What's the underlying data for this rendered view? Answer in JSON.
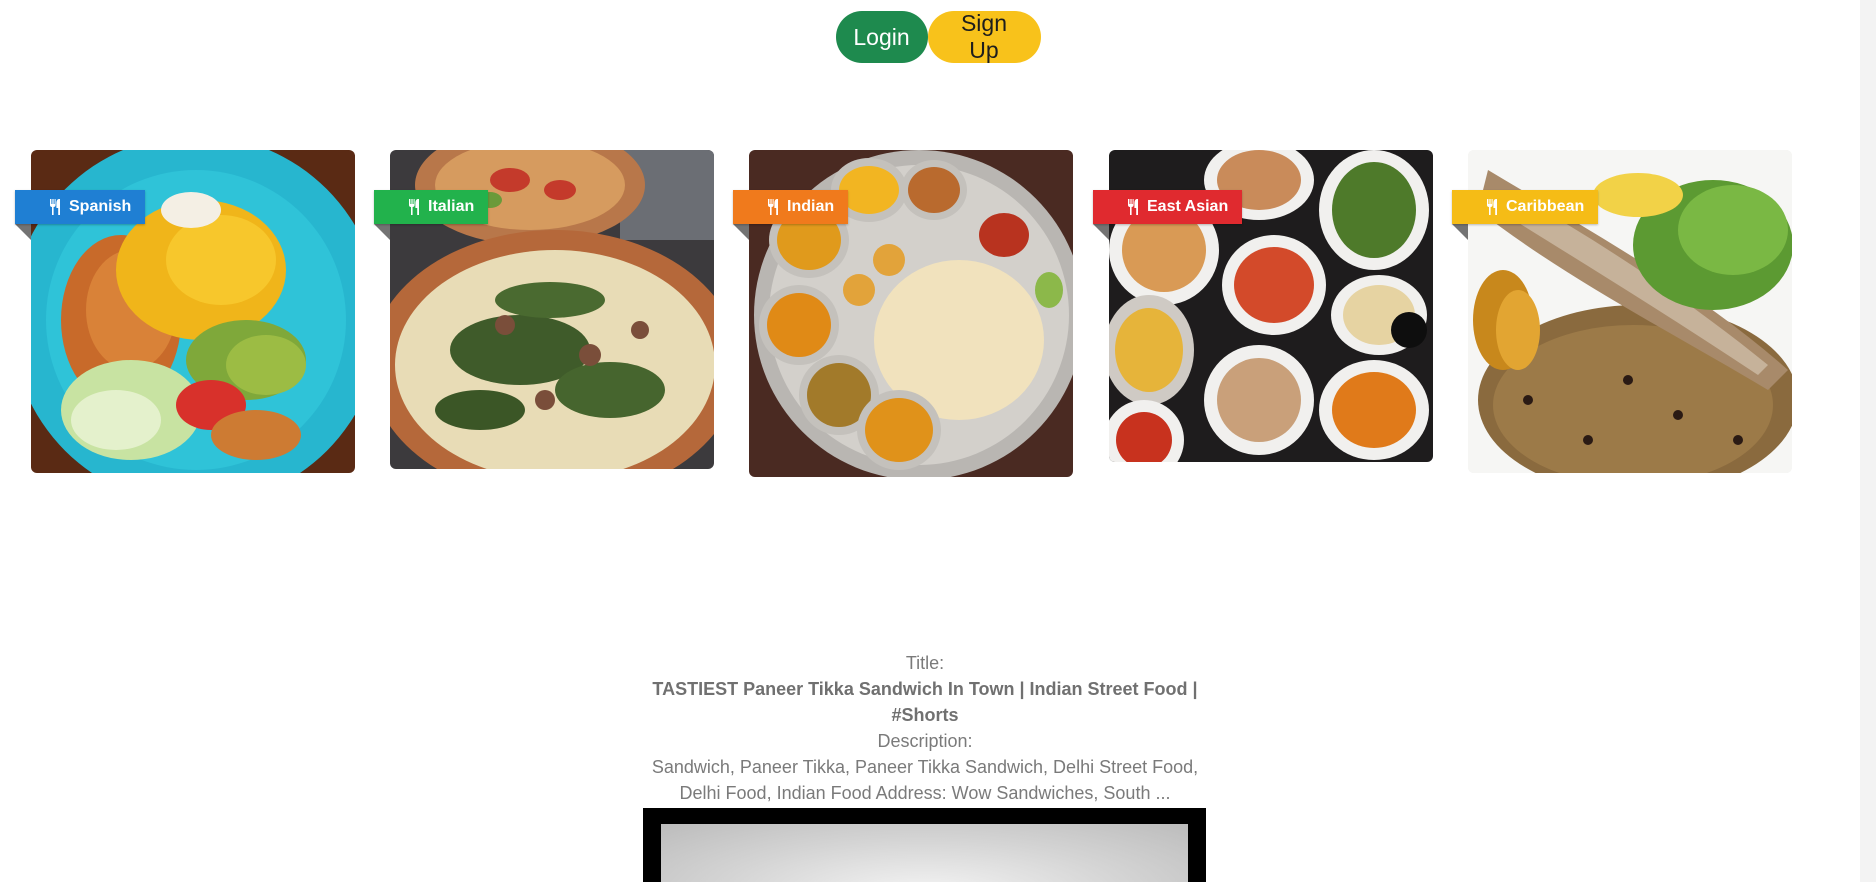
{
  "auth": {
    "login_label": "Login",
    "signup_label": "Sign Up"
  },
  "categories": [
    {
      "label": "Spanish",
      "color": "#1f7fd3"
    },
    {
      "label": "Italian",
      "color": "#22b24c"
    },
    {
      "label": "Indian",
      "color": "#f07a1c"
    },
    {
      "label": "East Asian",
      "color": "#e02a2f"
    },
    {
      "label": "Caribbean",
      "color": "#f5bc16"
    }
  ],
  "video": {
    "title_heading": "Title:",
    "title": "TASTIEST Paneer Tikka Sandwich In Town | Indian Street Food | #Shorts",
    "description_heading": "Description:",
    "description": "Sandwich, Paneer Tikka, Paneer Tikka Sandwich, Delhi Street Food, Delhi Food, Indian Food Address: Wow Sandwiches, South ..."
  },
  "icons": {
    "ribbon_icon": "utensils-icon"
  }
}
